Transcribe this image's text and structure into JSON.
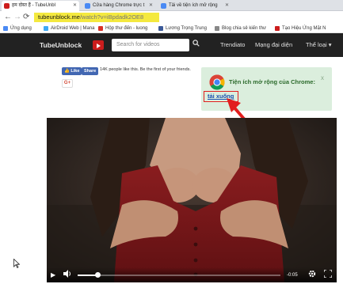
{
  "browser": {
    "tabs": [
      {
        "label": "हम दोस्त हैं - TubeUnbl",
        "active": true,
        "favicon_color": "#cc1d1d"
      },
      {
        "label": "Cửa hàng Chrome trực t",
        "active": false,
        "favicon_color": "#4a8af4"
      },
      {
        "label": "Tải về tiện ích mở rộng",
        "active": false,
        "favicon_color": "#4a8af4"
      }
    ],
    "nav": {
      "back": "←",
      "forward": "→",
      "reload": "⟳"
    },
    "address": {
      "url": "tubeunblock.me",
      "url_rest": "/watch?v=iBpdadk2OE8",
      "highlight_color": "#f4e93f"
    },
    "bookmarks": [
      {
        "label": "Ứng dụng",
        "icon_color": "#4a8af4"
      },
      {
        "label": "AirDroid Web | Mana",
        "icon_color": "#3fa9f5"
      },
      {
        "label": "Hộp thư đến - luong",
        "icon_color": "#d93025"
      },
      {
        "label": "Lương Trọng Trung",
        "icon_color": "#3b5998"
      },
      {
        "label": "Blog chia sẻ kiến thư",
        "icon_color": "#888888"
      },
      {
        "label": "Tạo Hiệu Ứng Mặt N",
        "icon_color": "#cc1d1d"
      }
    ]
  },
  "site": {
    "brand": "TubeUnblock",
    "search_placeholder": "Search for videos",
    "search_icon": "search-icon",
    "nav_links": [
      "Trendiato",
      "Mạng đại diện",
      "Thể loại ▾"
    ]
  },
  "social": {
    "like": "Like",
    "share": "Share",
    "text": "14K people like this. Be the first of your friends.",
    "gplus": "G+"
  },
  "popup": {
    "title": "Tiện ích mở rộng của Chrome:",
    "close": "x",
    "download_link": "tải xuống",
    "arrow_color": "#e21e1e",
    "bg_color": "#dbeedd"
  },
  "player": {
    "time": "-0:05",
    "progress": 0.1
  }
}
